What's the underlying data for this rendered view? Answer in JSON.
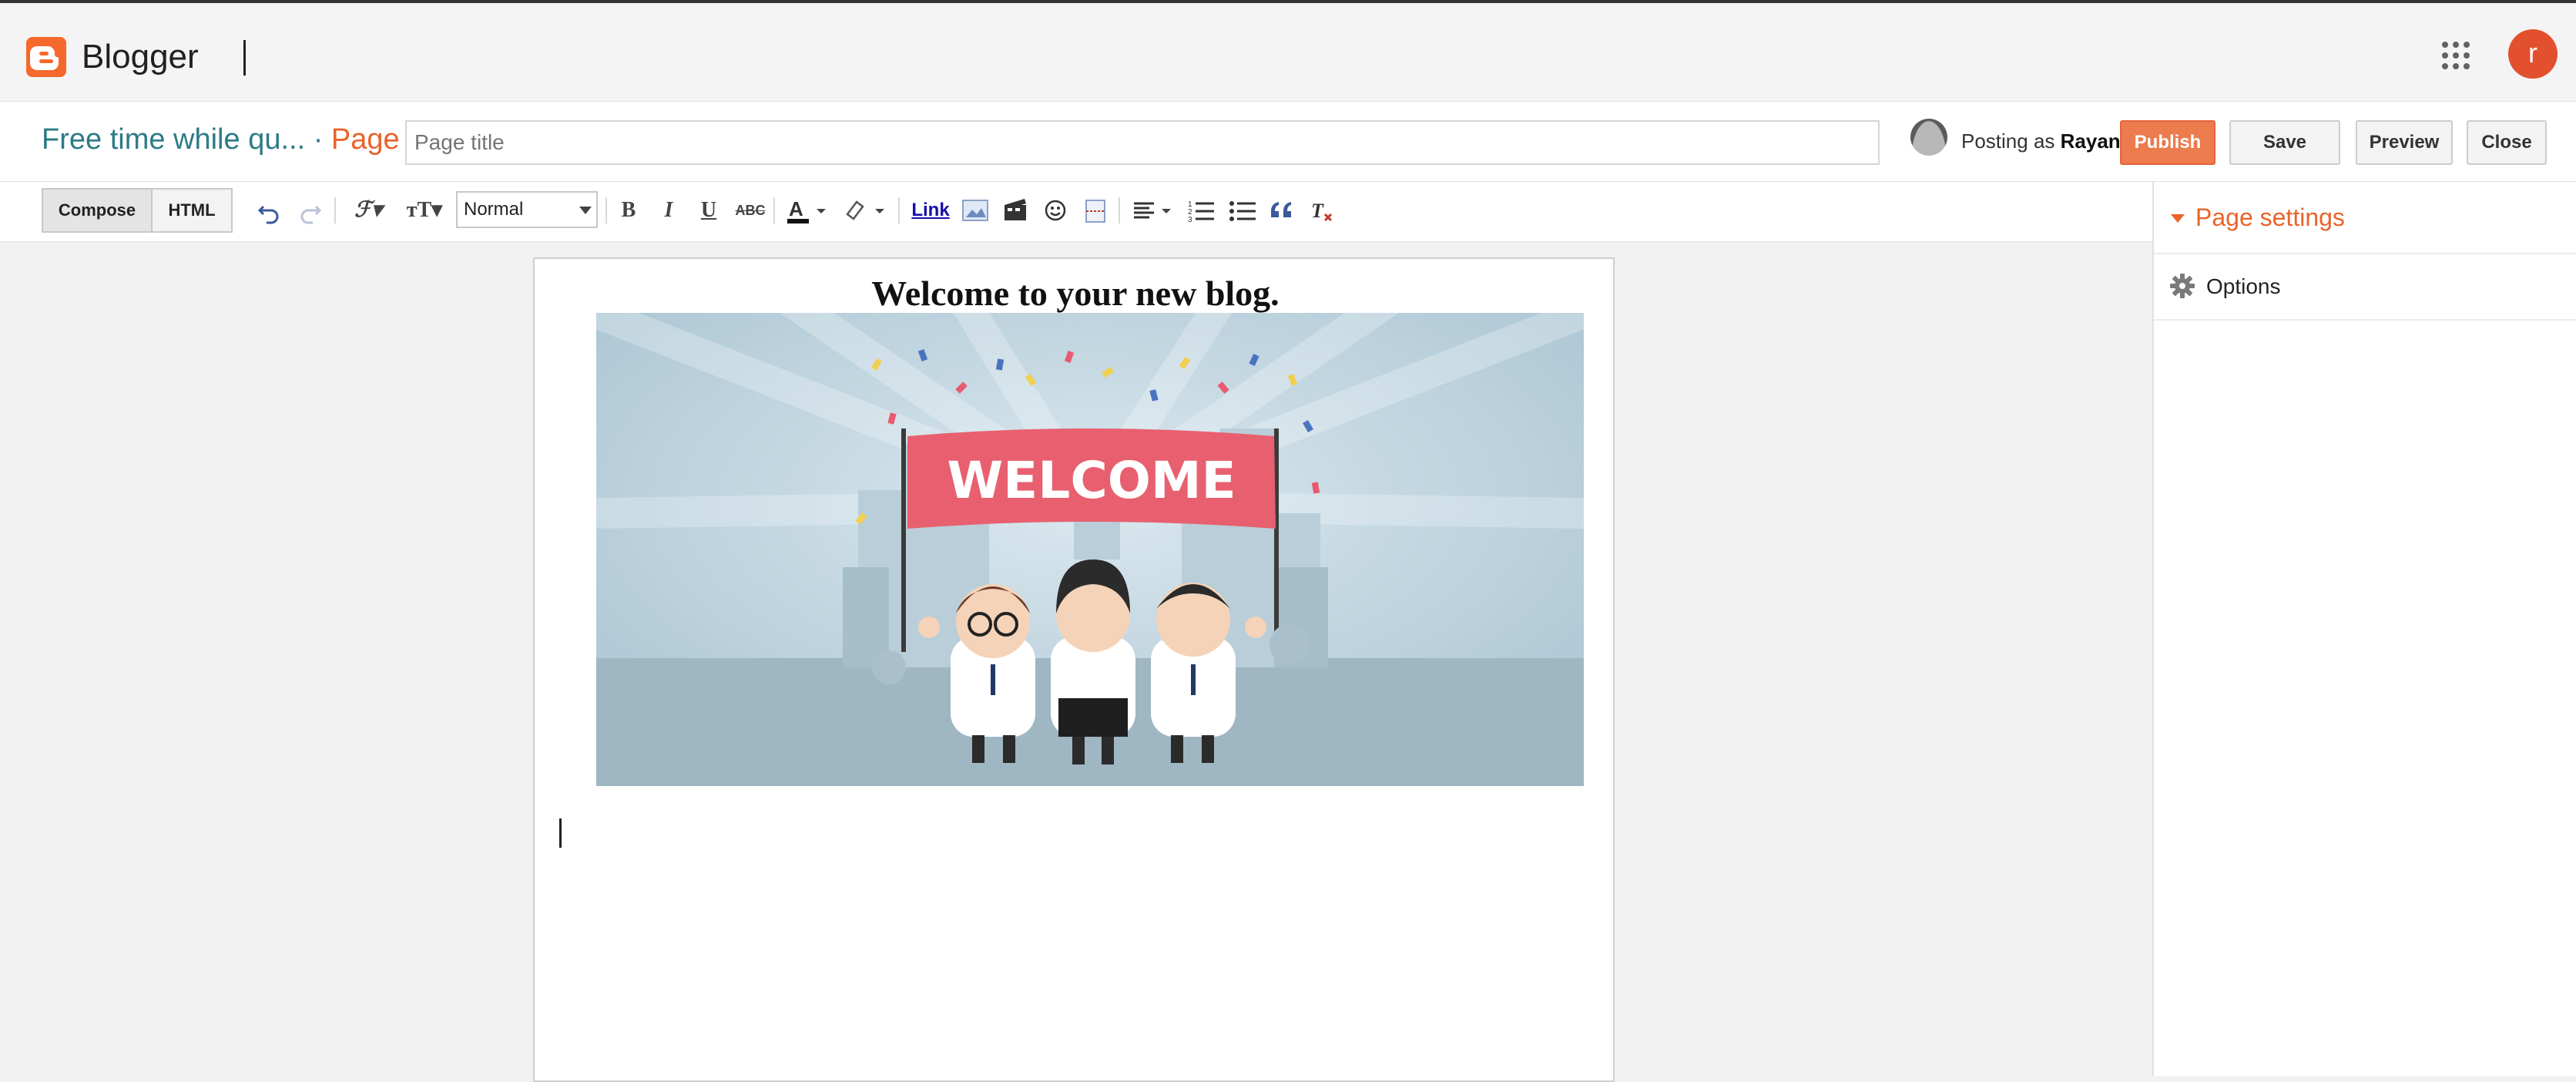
{
  "app": {
    "brand": "Blogger",
    "user_initial": "r"
  },
  "header": {
    "blog_name": "Free time while qu...",
    "separator": "·",
    "type_label": "Page",
    "title_placeholder": "Page title",
    "posting_prefix": "Posting as",
    "posting_user": "Rayan",
    "buttons": {
      "publish": "Publish",
      "save": "Save",
      "preview": "Preview",
      "close": "Close"
    }
  },
  "toolbar": {
    "compose": "Compose",
    "html": "HTML",
    "format_value": "Normal",
    "link": "Link",
    "icons": [
      "undo-icon",
      "redo-icon",
      "font-family-icon",
      "font-size-icon",
      "bold-icon",
      "italic-icon",
      "underline-icon",
      "strikethrough-icon",
      "text-color-icon",
      "highlight-icon",
      "image-icon",
      "video-icon",
      "emoji-icon",
      "jump-break-icon",
      "align-icon",
      "numbered-list-icon",
      "bulleted-list-icon",
      "quote-icon",
      "remove-formatting-icon"
    ]
  },
  "editor": {
    "heading": "Welcome to your new blog.",
    "image": {
      "banner_text": "WELCOME"
    }
  },
  "sidebar": {
    "section_title": "Page settings",
    "items": [
      {
        "label": "Options",
        "icon": "gear-icon"
      }
    ]
  },
  "colors": {
    "brand_orange": "#f5692d",
    "publish": "#ec7b4e",
    "teal": "#2d7b86",
    "accent": "#e9632b"
  }
}
